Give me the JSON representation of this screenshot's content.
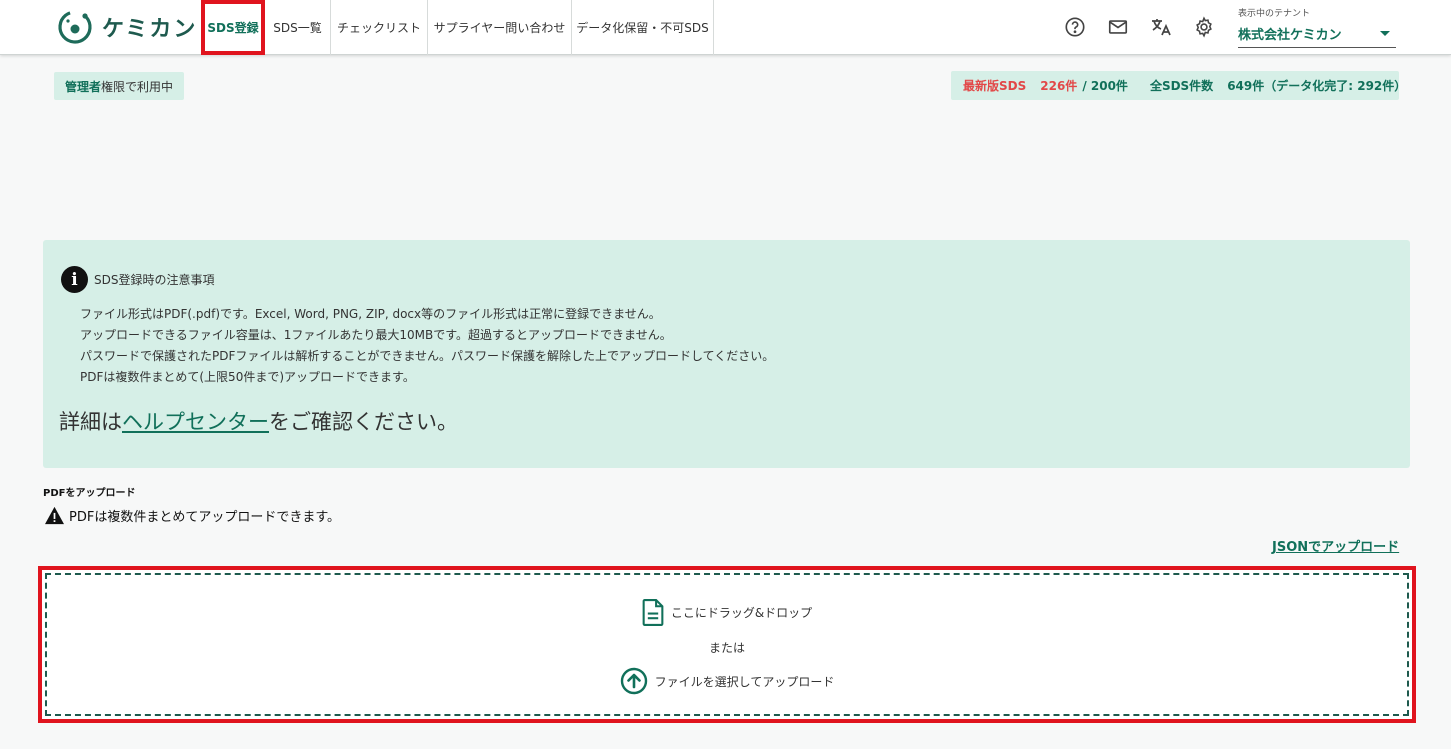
{
  "header": {
    "logo_text": "ケミカン",
    "nav": [
      {
        "label": "SDS登録",
        "active": true
      },
      {
        "label": "SDS一覧"
      },
      {
        "label": "チェックリスト"
      },
      {
        "label": "サプライヤー問い合わせ"
      },
      {
        "label": "データ化保留・不可SDS"
      }
    ],
    "icons": [
      "help-icon",
      "mail-icon",
      "translate-icon",
      "settings-icon"
    ],
    "tenant": {
      "label": "表示中のテナント",
      "value": "株式会社ケミカン"
    }
  },
  "badges": {
    "admin_strong": "管理者",
    "admin_rest": "権限で利用中",
    "latest_label": "最新版SDS",
    "latest_count": "226件",
    "latest_limit": "/ 200件",
    "total_label": "全SDS件数",
    "total_value": "649件（データ化完了: 292件）"
  },
  "notice": {
    "title": "SDS登録時の注意事項",
    "lines": [
      "ファイル形式はPDF(.pdf)です。Excel, Word, PNG, ZIP, docx等のファイル形式は正常に登録できません。",
      "アップロードできるファイル容量は、1ファイルあたり最大10MBです。超過するとアップロードできません。",
      "パスワードで保護されたPDFファイルは解析することができません。パスワード保護を解除した上でアップロードしてください。",
      "PDFは複数件まとめて(上限50件まで)アップロードできます。"
    ],
    "help_prefix": "詳細は",
    "help_link": "ヘルプセンター",
    "help_suffix": "をご確認ください。"
  },
  "upload": {
    "title": "PDFをアップロード",
    "warning": "PDFは複数件まとめてアップロードできます。",
    "json_link": "JSONでアップロード",
    "drop_text": "ここにドラッグ&ドロップ",
    "or_text": "または",
    "select_text": "ファイルを選択してアップロード"
  },
  "colors": {
    "brand": "#11705a",
    "highlight_border": "#e0141e",
    "panel": "#d6efe7",
    "alert": "#e24848"
  }
}
